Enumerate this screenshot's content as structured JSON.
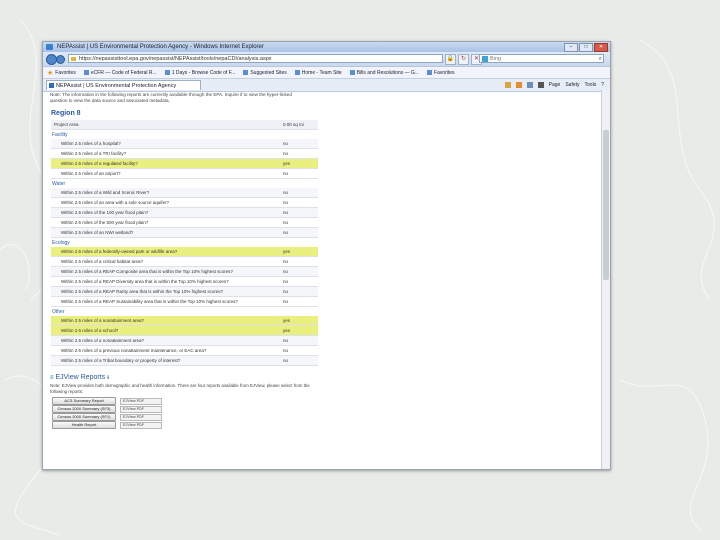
{
  "window": {
    "title": "NEPAssist | US Environmental Protection Agency - Windows Internet Explorer",
    "address": "https://nepassisttool.epa.gov/nepassist/NEPAssist/tools/nepaCDI/analysis.aspx",
    "search_placeholder": "Bing"
  },
  "favorites_bar": {
    "favorites_label": "Favorites",
    "items": [
      "eCFR — Code of Federal R...",
      "1 Days - Browse Code of F...",
      "Suggested Sites",
      "Home - Team Site",
      "Bills and Resolutions — G...",
      "Favorites"
    ]
  },
  "tab": {
    "label": "NEPAssist | US Environmental Protection Agency"
  },
  "command_bar": {
    "page": "Page",
    "safety": "Safety",
    "tools": "Tools",
    "help": "?"
  },
  "intro_text": "Note: The information in the following reports are currently available through the EPA. Inquire if to view the hyper-linked question to view the data source and associated metadata.",
  "region_title": "Region 8",
  "table": {
    "header_left": "Project Area",
    "header_right": "0.00 sq mi",
    "categories": [
      {
        "name": "Facility",
        "rows": [
          {
            "q": "Within 2.5 miles of a hospital?",
            "a": "no",
            "hl": false
          },
          {
            "q": "Within 2.5 miles of a TRI facility?",
            "a": "no",
            "hl": false
          },
          {
            "q": "Within 2.5 miles of a regulated facility?",
            "a": "yes",
            "hl": true
          },
          {
            "q": "Within 2.5 miles of an airport?",
            "a": "no",
            "hl": false
          }
        ]
      },
      {
        "name": "Water",
        "rows": [
          {
            "q": "Within 2.5 miles of a Wild and Scenic River?",
            "a": "no",
            "hl": false
          },
          {
            "q": "Within 2.5 miles of an area with a sole source aquifer?",
            "a": "no",
            "hl": false
          },
          {
            "q": "Within 2.5 miles of the 100 year flood plain?",
            "a": "no",
            "hl": false
          },
          {
            "q": "Within 2.5 miles of the 500 year flood plain?",
            "a": "no",
            "hl": false
          },
          {
            "q": "Within 2.5 miles of an NWI wetland?",
            "a": "no",
            "hl": false
          }
        ]
      },
      {
        "name": "Ecology",
        "rows": [
          {
            "q": "Within 2.5 miles of a federally-owned park or wildlife area?",
            "a": "yes",
            "hl": true
          },
          {
            "q": "Within 2.5 miles of a critical habitat area?",
            "a": "no",
            "hl": false
          },
          {
            "q": "Within 2.5 miles of a REAP Composite area that is within the Top 10% highest scores?",
            "a": "no",
            "hl": false
          },
          {
            "q": "Within 2.5 miles of a REAP Diversity area that is within the Top 10% highest scores?",
            "a": "no",
            "hl": false
          },
          {
            "q": "Within 2.5 miles of a REAP Rarity area that is within the Top 10% highest scores?",
            "a": "no",
            "hl": false
          },
          {
            "q": "Within 2.5 miles of a REAP Sustainability area that is within the Top 10% highest scores?",
            "a": "no",
            "hl": false
          }
        ]
      },
      {
        "name": "Other",
        "rows": [
          {
            "q": "Within 2.5 miles of a nonattainment area?",
            "a": "yes",
            "hl": true
          },
          {
            "q": "Within 2.5 miles of a school?",
            "a": "yes",
            "hl": true
          },
          {
            "q": "Within 2.5 miles of a nonattainment area?",
            "a": "no",
            "hl": false
          },
          {
            "q": "Within 2.5 miles of a previous nonattainment maintenance, or EAC area?",
            "a": "no",
            "hl": false
          },
          {
            "q": "Within 2.5 miles of a Tribal boundary or property of interest?",
            "a": "no",
            "hl": false
          }
        ]
      }
    ]
  },
  "ejview": {
    "title": "EJView Reports",
    "text": "Note: EJView provides both demographic and health information. There are four reports available from EJView, please select from the following reports:",
    "reports": [
      {
        "button": "ACS Summary Report",
        "link": "EJView PDF"
      },
      {
        "button": "Census 2000 Summary (SF3)",
        "link": "EJView PDF"
      },
      {
        "button": "Census 2000 Summary (SF1)",
        "link": "EJView PDF"
      },
      {
        "button": "Health Report",
        "link": "EJView PDF"
      }
    ]
  }
}
